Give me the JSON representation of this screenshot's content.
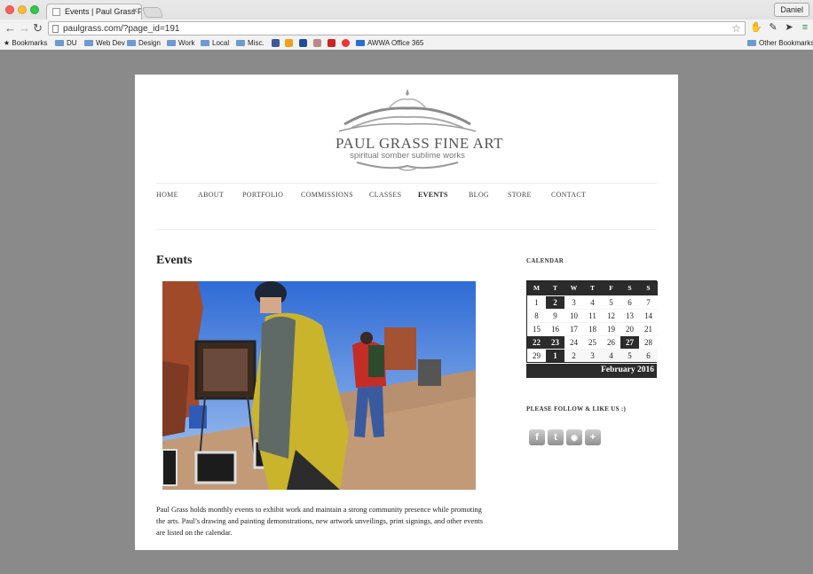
{
  "browser": {
    "tab_title": "Events | Paul Grass Fine Art",
    "tab_close": "×",
    "profile_name": "Daniel",
    "url": "paulgrass.com/?page_id=191",
    "bookmarks": [
      "Bookmarks",
      "DU",
      "Web Dev",
      "Design",
      "Work",
      "Local",
      "Misc.",
      "AWWA Office 365",
      "Other Bookmarks"
    ]
  },
  "site": {
    "logo_title": "PAUL GRASS FINE ART",
    "logo_subtitle": "spiritual somber sublime works",
    "nav": [
      "HOME",
      "ABOUT",
      "PORTFOLIO",
      "COMMISSIONS",
      "CLASSES",
      "EVENTS",
      "BLOG",
      "STORE",
      "CONTACT"
    ],
    "active_nav": "EVENTS"
  },
  "main": {
    "title": "Events",
    "description": "Paul Grass holds monthly events to exhibit work and maintain a strong community presence while promoting the arts. Paul’s drawing and painting demonstrations, new artwork unveilings, print signings, and other events are listed on the calendar."
  },
  "sidebar": {
    "calendar_title": "CALENDAR",
    "weekdays": [
      "M",
      "T",
      "W",
      "T",
      "F",
      "S",
      "S"
    ],
    "weeks": [
      [
        "1",
        "2",
        "3",
        "4",
        "5",
        "6",
        "7"
      ],
      [
        "8",
        "9",
        "10",
        "11",
        "12",
        "13",
        "14"
      ],
      [
        "15",
        "16",
        "17",
        "18",
        "19",
        "20",
        "21"
      ],
      [
        "22",
        "23",
        "24",
        "25",
        "26",
        "27",
        "28"
      ],
      [
        "29",
        "1",
        "2",
        "3",
        "4",
        "5",
        "6"
      ]
    ],
    "event_days": [
      "2",
      "22",
      "23",
      "27",
      "next-1"
    ],
    "month_label": "February 2016",
    "follow_title": "PLEASE FOLLOW & LIKE US :)",
    "social": [
      "facebook-icon",
      "twitter-icon",
      "rss-icon",
      "plus-icon"
    ]
  },
  "colors": {
    "browser_bg": "#8a8a8a",
    "calendar_dark": "#2b2b2b",
    "text": "#222222"
  }
}
